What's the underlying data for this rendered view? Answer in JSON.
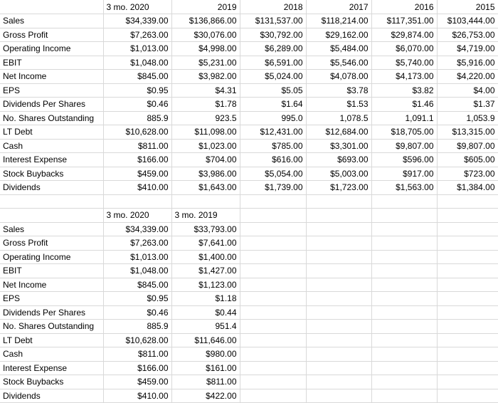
{
  "document": {
    "type": "spreadsheet",
    "app": "spreadsheet-grid",
    "gridline_color": "#d9d9d9",
    "text_color": "#000000",
    "background_color": "#ffffff"
  },
  "table_one": {
    "name": "annual-financials",
    "corner_label": "",
    "columns": [
      "3 mo. 2020",
      "2019",
      "2018",
      "2017",
      "2016",
      "2015"
    ],
    "rows": [
      {
        "label": "Sales",
        "values": [
          "$34,339.00",
          "$136,866.00",
          "$131,537.00",
          "$118,214.00",
          "$117,351.00",
          "$103,444.00"
        ]
      },
      {
        "label": "Gross Profit",
        "values": [
          "$7,263.00",
          "$30,076.00",
          "$30,792.00",
          "$29,162.00",
          "$29,874.00",
          "$26,753.00"
        ]
      },
      {
        "label": "Operating Income",
        "values": [
          "$1,013.00",
          "$4,998.00",
          "$6,289.00",
          "$5,484.00",
          "$6,070.00",
          "$4,719.00"
        ]
      },
      {
        "label": "EBIT",
        "values": [
          "$1,048.00",
          "$5,231.00",
          "$6,591.00",
          "$5,546.00",
          "$5,740.00",
          "$5,916.00"
        ]
      },
      {
        "label": "Net Income",
        "values": [
          "$845.00",
          "$3,982.00",
          "$5,024.00",
          "$4,078.00",
          "$4,173.00",
          "$4,220.00"
        ]
      },
      {
        "label": "EPS",
        "values": [
          "$0.95",
          "$4.31",
          "$5.05",
          "$3.78",
          "$3.82",
          "$4.00"
        ]
      },
      {
        "label": "Dividends Per Shares",
        "values": [
          "$0.46",
          "$1.78",
          "$1.64",
          "$1.53",
          "$1.46",
          "$1.37"
        ]
      },
      {
        "label": "No. Shares Outstanding",
        "values": [
          "885.9",
          "923.5",
          "995.0",
          "1,078.5",
          "1,091.1",
          "1,053.9"
        ]
      },
      {
        "label": "LT Debt",
        "values": [
          "$10,628.00",
          "$11,098.00",
          "$12,431.00",
          "$12,684.00",
          "$18,705.00",
          "$13,315.00"
        ]
      },
      {
        "label": "Cash",
        "values": [
          "$811.00",
          "$1,023.00",
          "$785.00",
          "$3,301.00",
          "$9,807.00",
          "$9,807.00"
        ]
      },
      {
        "label": "Interest Expense",
        "values": [
          "$166.00",
          "$704.00",
          "$616.00",
          "$693.00",
          "$596.00",
          "$605.00"
        ]
      },
      {
        "label": "Stock Buybacks",
        "values": [
          "$459.00",
          "$3,986.00",
          "$5,054.00",
          "$5,003.00",
          "$917.00",
          "$723.00"
        ]
      },
      {
        "label": "Dividends",
        "values": [
          "$410.00",
          "$1,643.00",
          "$1,739.00",
          "$1,723.00",
          "$1,563.00",
          "$1,384.00"
        ]
      }
    ]
  },
  "spacer_row": {
    "label": "",
    "values": [
      "",
      "",
      "",
      "",
      "",
      ""
    ]
  },
  "table_two": {
    "name": "quarterly-comparison",
    "corner_label": "",
    "columns": [
      "3 mo. 2020",
      "3 mo. 2019",
      "",
      "",
      "",
      ""
    ],
    "rows": [
      {
        "label": "Sales",
        "values": [
          "$34,339.00",
          "$33,793.00",
          "",
          "",
          "",
          ""
        ]
      },
      {
        "label": "Gross Profit",
        "values": [
          "$7,263.00",
          "$7,641.00",
          "",
          "",
          "",
          ""
        ]
      },
      {
        "label": "Operating Income",
        "values": [
          "$1,013.00",
          "$1,400.00",
          "",
          "",
          "",
          ""
        ]
      },
      {
        "label": "EBIT",
        "values": [
          "$1,048.00",
          "$1,427.00",
          "",
          "",
          "",
          ""
        ]
      },
      {
        "label": "Net Income",
        "values": [
          "$845.00",
          "$1,123.00",
          "",
          "",
          "",
          ""
        ]
      },
      {
        "label": "EPS",
        "values": [
          "$0.95",
          "$1.18",
          "",
          "",
          "",
          ""
        ]
      },
      {
        "label": "Dividends Per Shares",
        "values": [
          "$0.46",
          "$0.44",
          "",
          "",
          "",
          ""
        ]
      },
      {
        "label": "No. Shares Outstanding",
        "values": [
          "885.9",
          "951.4",
          "",
          "",
          "",
          ""
        ]
      },
      {
        "label": "LT Debt",
        "values": [
          "$10,628.00",
          "$11,646.00",
          "",
          "",
          "",
          ""
        ]
      },
      {
        "label": "Cash",
        "values": [
          "$811.00",
          "$980.00",
          "",
          "",
          "",
          ""
        ]
      },
      {
        "label": "Interest Expense",
        "values": [
          "$166.00",
          "$161.00",
          "",
          "",
          "",
          ""
        ]
      },
      {
        "label": "Stock Buybacks",
        "values": [
          "$459.00",
          "$811.00",
          "",
          "",
          "",
          ""
        ]
      },
      {
        "label": "Dividends",
        "values": [
          "$410.00",
          "$422.00",
          "",
          "",
          "",
          ""
        ]
      }
    ]
  }
}
